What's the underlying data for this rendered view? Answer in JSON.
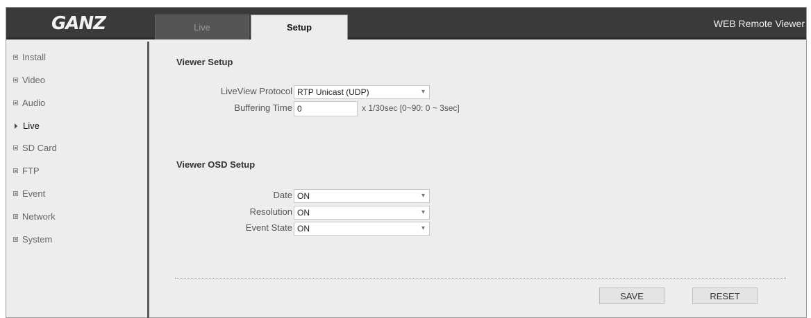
{
  "header": {
    "logo_text": "GANZ",
    "tabs": [
      {
        "label": "Live",
        "active": false
      },
      {
        "label": "Setup",
        "active": true
      }
    ],
    "app_title": "WEB Remote Viewer"
  },
  "sidebar": {
    "items": [
      {
        "label": "Install",
        "active": false
      },
      {
        "label": "Video",
        "active": false
      },
      {
        "label": "Audio",
        "active": false
      },
      {
        "label": "Live",
        "active": true
      },
      {
        "label": "SD Card",
        "active": false
      },
      {
        "label": "FTP",
        "active": false
      },
      {
        "label": "Event",
        "active": false
      },
      {
        "label": "Network",
        "active": false
      },
      {
        "label": "System",
        "active": false
      }
    ]
  },
  "viewer_setup": {
    "title": "Viewer Setup",
    "protocol_label": "LiveView Protocol",
    "protocol_value": "RTP Unicast (UDP)",
    "buffering_label": "Buffering Time",
    "buffering_value": "0",
    "buffering_hint": "x 1/30sec [0~90: 0 ~ 3sec]"
  },
  "osd_setup": {
    "title": "Viewer OSD Setup",
    "date_label": "Date",
    "date_value": "ON",
    "resolution_label": "Resolution",
    "resolution_value": "ON",
    "event_state_label": "Event State",
    "event_state_value": "ON"
  },
  "actions": {
    "save_label": "SAVE",
    "reset_label": "RESET"
  },
  "icons": {
    "dropdown": "chevron-down-icon",
    "sidebar_bullet": "square-bullet-icon",
    "active_marker": "triangle-right-icon"
  },
  "colors": {
    "header_bg": "#3a3a3a",
    "content_bg": "#ededed"
  }
}
